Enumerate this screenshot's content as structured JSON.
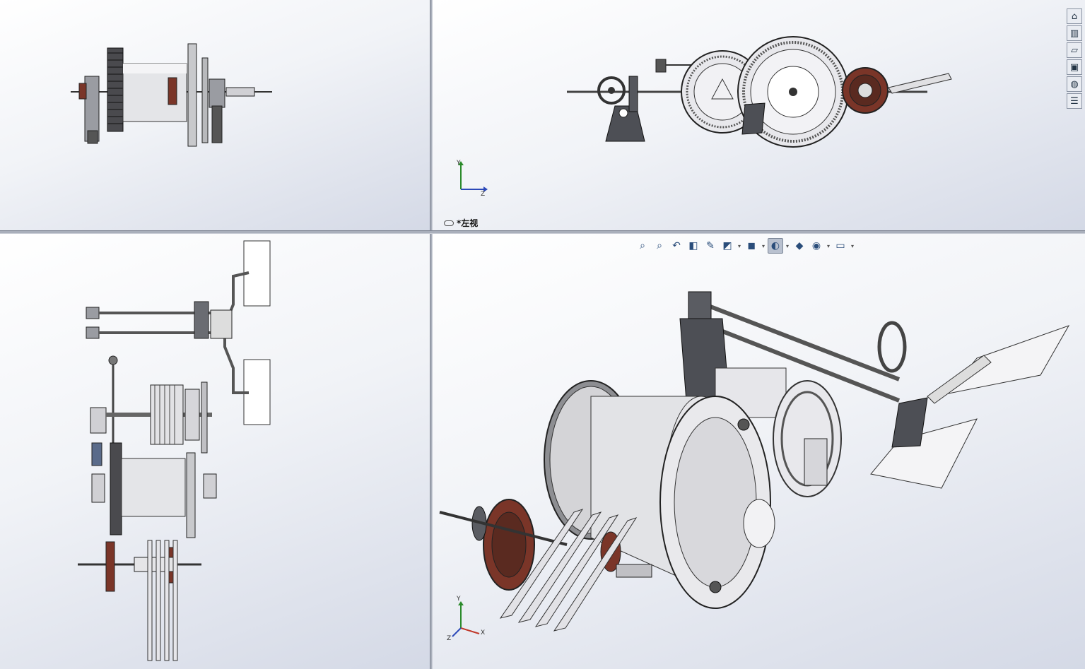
{
  "viewports": {
    "top_right": {
      "view_name": "*左视"
    }
  },
  "triad_labels": {
    "x": "X",
    "y": "Y",
    "z": "Z"
  },
  "hud_toolbar": [
    {
      "name": "zoom-to-fit-icon",
      "glyph": "⌕"
    },
    {
      "name": "zoom-to-area-icon",
      "glyph": "⌕"
    },
    {
      "name": "previous-view-icon",
      "glyph": "↶"
    },
    {
      "name": "section-view-icon",
      "glyph": "◧"
    },
    {
      "name": "dynamic-annotation-icon",
      "glyph": "✎"
    },
    {
      "name": "view-orientation-icon",
      "glyph": "◩"
    },
    {
      "name": "display-style-icon",
      "glyph": "◼"
    },
    {
      "name": "hide-show-items-icon",
      "glyph": "◐"
    },
    {
      "name": "edit-appearance-icon",
      "glyph": "◆"
    },
    {
      "name": "apply-scene-icon",
      "glyph": "◉"
    },
    {
      "name": "view-settings-icon",
      "glyph": "▭"
    }
  ],
  "task_pane": [
    {
      "name": "home-icon",
      "glyph": "⌂"
    },
    {
      "name": "design-library-icon",
      "glyph": "▥"
    },
    {
      "name": "file-explorer-icon",
      "glyph": "▱"
    },
    {
      "name": "view-palette-icon",
      "glyph": "▣"
    },
    {
      "name": "appearances-icon",
      "glyph": "◍"
    },
    {
      "name": "custom-properties-icon",
      "glyph": "☰"
    }
  ],
  "colors": {
    "part_gray": "#d9dadd",
    "part_dark": "#4d4f55",
    "gear_brown": "#7a3528",
    "edge": "#222222"
  }
}
